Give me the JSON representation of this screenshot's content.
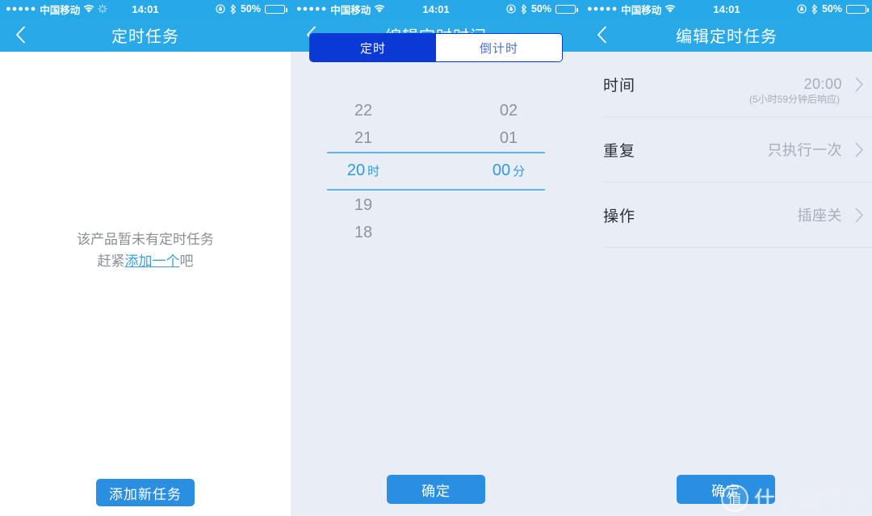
{
  "status_bar": {
    "signal_dots": "●●●●●",
    "carrier": "中国移动",
    "time": "14:01",
    "battery_percent": "50%",
    "battery_level": 50,
    "icons": {
      "wifi": "wifi-icon",
      "activity": "network-activity-icon",
      "rotation_lock": "rotation-lock-icon",
      "bluetooth": "bluetooth-icon",
      "battery": "battery-icon"
    }
  },
  "colors": {
    "nav_blue": "#29a9e8",
    "status_blue": "#27a8e8",
    "panel_bg": "#e9edf5",
    "segment_active": "#0a39d6",
    "button_blue": "#2a8fe0",
    "picker_accent": "#2e9ae4",
    "link_blue": "#3c9ee0"
  },
  "panel1": {
    "nav": {
      "title": "定时任务",
      "back": "back-chevron"
    },
    "empty_state": {
      "line1": "该产品暂未有定时任务",
      "line2_prefix": "赶紧",
      "line2_link": "添加一个",
      "line2_suffix": "吧"
    },
    "add_button": "添加新任务"
  },
  "panel2": {
    "nav": {
      "title": "编辑定时时间",
      "back": "back-chevron"
    },
    "segments": [
      {
        "label": "定时",
        "active": true
      },
      {
        "label": "倒计时",
        "active": false
      }
    ],
    "picker": {
      "hours": [
        "22",
        "21",
        "20",
        "19",
        "18"
      ],
      "hours_selected": "20",
      "hours_unit": "时",
      "minutes": [
        "02",
        "01",
        "00"
      ],
      "minutes_selected": "00",
      "minutes_unit": "分"
    },
    "confirm_button": "确定"
  },
  "panel3": {
    "nav": {
      "title": "编辑定时任务",
      "back": "back-chevron"
    },
    "rows": [
      {
        "label": "时间",
        "value": "20:00",
        "sub": "(5小时59分钟后响应)"
      },
      {
        "label": "重复",
        "value": "只执行一次",
        "sub": ""
      },
      {
        "label": "操作",
        "value": "插座关",
        "sub": ""
      }
    ],
    "confirm_button": "确定"
  },
  "watermark": {
    "logo_char": "值",
    "text": "什么值得买"
  }
}
